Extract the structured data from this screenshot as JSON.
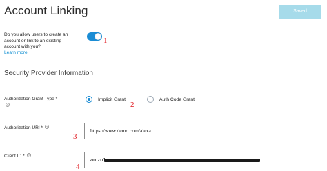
{
  "header": {
    "title": "Account Linking",
    "save_label": "Saved"
  },
  "account_linking": {
    "question": "Do you allow users to create an account or link to an existing account with you?",
    "learn_more": "Learn more.",
    "enabled": true
  },
  "security_provider": {
    "section_title": "Security Provider Information",
    "grant_type": {
      "label": "Authorization Grant Type *",
      "options": [
        "Implicit Grant",
        "Auth Code Grant"
      ],
      "selected": "Implicit Grant"
    },
    "authorization_uri": {
      "label": "Authorization URI *",
      "value": "https://www.demo.com/alexa"
    },
    "client_id": {
      "label": "Client ID *",
      "value_prefix": "amzn1"
    }
  },
  "annotations": [
    "1",
    "2",
    "3",
    "4"
  ],
  "colors": {
    "accent": "#1b8cd4",
    "save_button": "#a6dbea",
    "annotation": "#e0141b"
  },
  "icons": {
    "help": "help-circle-icon"
  }
}
